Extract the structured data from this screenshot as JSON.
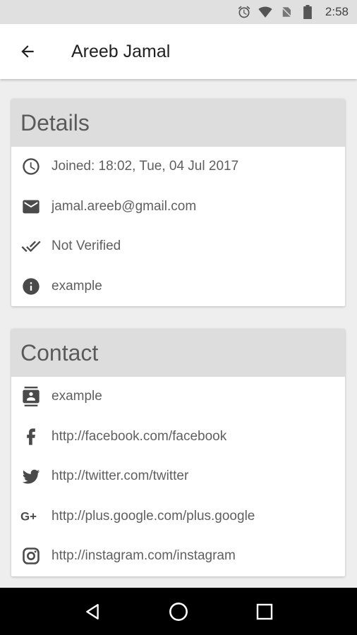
{
  "status_bar": {
    "time": "2:58",
    "icons": [
      "alarm-icon",
      "wifi-icon",
      "no-sim-icon",
      "battery-icon"
    ]
  },
  "app_bar": {
    "title": "Areeb Jamal",
    "back_icon": "arrow-left-icon"
  },
  "details": {
    "header": "Details",
    "items": [
      {
        "icon": "clock-icon",
        "text": "Joined: 18:02, Tue, 04 Jul 2017"
      },
      {
        "icon": "email-icon",
        "text": "jamal.areeb@gmail.com"
      },
      {
        "icon": "double-check-icon",
        "text": "Not Verified"
      },
      {
        "icon": "info-icon",
        "text": "example"
      }
    ]
  },
  "contact": {
    "header": "Contact",
    "items": [
      {
        "icon": "contact-card-icon",
        "text": "example"
      },
      {
        "icon": "facebook-icon",
        "text": "http://facebook.com/facebook"
      },
      {
        "icon": "twitter-icon",
        "text": "http://twitter.com/twitter"
      },
      {
        "icon": "google-plus-icon",
        "text": "http://plus.google.com/plus.google"
      },
      {
        "icon": "instagram-icon",
        "text": "http://instagram.com/instagram"
      }
    ]
  },
  "nav_bar": {
    "icons": [
      "nav-back-icon",
      "nav-home-icon",
      "nav-recents-icon"
    ]
  },
  "colors": {
    "status_bar": "#e0e0e0",
    "card_header": "#dddddd",
    "background": "#eeeeee",
    "icon": "#4a4a4a"
  }
}
